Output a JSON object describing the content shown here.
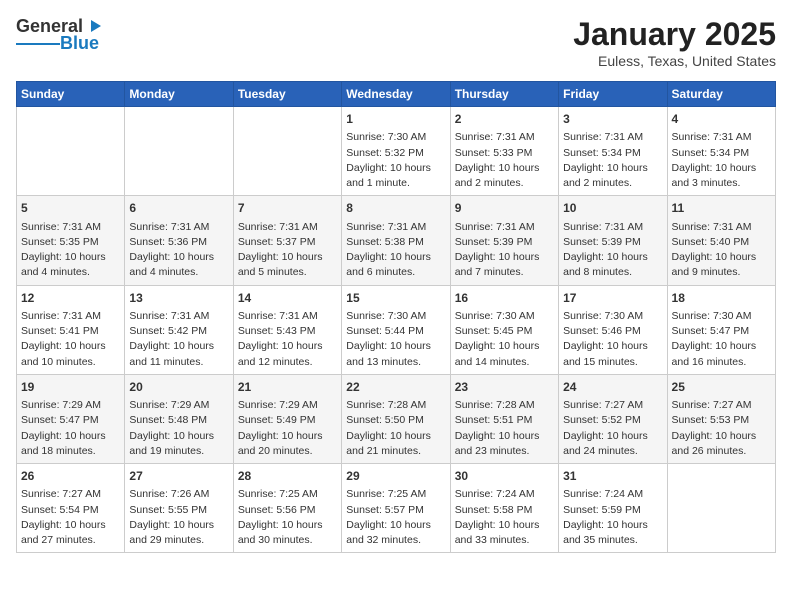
{
  "app": {
    "logo_general": "General",
    "logo_blue": "Blue",
    "title": "January 2025",
    "subtitle": "Euless, Texas, United States"
  },
  "calendar": {
    "headers": [
      "Sunday",
      "Monday",
      "Tuesday",
      "Wednesday",
      "Thursday",
      "Friday",
      "Saturday"
    ],
    "weeks": [
      [
        {
          "day": "",
          "info": ""
        },
        {
          "day": "",
          "info": ""
        },
        {
          "day": "",
          "info": ""
        },
        {
          "day": "1",
          "info": "Sunrise: 7:30 AM\nSunset: 5:32 PM\nDaylight: 10 hours\nand 1 minute."
        },
        {
          "day": "2",
          "info": "Sunrise: 7:31 AM\nSunset: 5:33 PM\nDaylight: 10 hours\nand 2 minutes."
        },
        {
          "day": "3",
          "info": "Sunrise: 7:31 AM\nSunset: 5:34 PM\nDaylight: 10 hours\nand 2 minutes."
        },
        {
          "day": "4",
          "info": "Sunrise: 7:31 AM\nSunset: 5:34 PM\nDaylight: 10 hours\nand 3 minutes."
        }
      ],
      [
        {
          "day": "5",
          "info": "Sunrise: 7:31 AM\nSunset: 5:35 PM\nDaylight: 10 hours\nand 4 minutes."
        },
        {
          "day": "6",
          "info": "Sunrise: 7:31 AM\nSunset: 5:36 PM\nDaylight: 10 hours\nand 4 minutes."
        },
        {
          "day": "7",
          "info": "Sunrise: 7:31 AM\nSunset: 5:37 PM\nDaylight: 10 hours\nand 5 minutes."
        },
        {
          "day": "8",
          "info": "Sunrise: 7:31 AM\nSunset: 5:38 PM\nDaylight: 10 hours\nand 6 minutes."
        },
        {
          "day": "9",
          "info": "Sunrise: 7:31 AM\nSunset: 5:39 PM\nDaylight: 10 hours\nand 7 minutes."
        },
        {
          "day": "10",
          "info": "Sunrise: 7:31 AM\nSunset: 5:39 PM\nDaylight: 10 hours\nand 8 minutes."
        },
        {
          "day": "11",
          "info": "Sunrise: 7:31 AM\nSunset: 5:40 PM\nDaylight: 10 hours\nand 9 minutes."
        }
      ],
      [
        {
          "day": "12",
          "info": "Sunrise: 7:31 AM\nSunset: 5:41 PM\nDaylight: 10 hours\nand 10 minutes."
        },
        {
          "day": "13",
          "info": "Sunrise: 7:31 AM\nSunset: 5:42 PM\nDaylight: 10 hours\nand 11 minutes."
        },
        {
          "day": "14",
          "info": "Sunrise: 7:31 AM\nSunset: 5:43 PM\nDaylight: 10 hours\nand 12 minutes."
        },
        {
          "day": "15",
          "info": "Sunrise: 7:30 AM\nSunset: 5:44 PM\nDaylight: 10 hours\nand 13 minutes."
        },
        {
          "day": "16",
          "info": "Sunrise: 7:30 AM\nSunset: 5:45 PM\nDaylight: 10 hours\nand 14 minutes."
        },
        {
          "day": "17",
          "info": "Sunrise: 7:30 AM\nSunset: 5:46 PM\nDaylight: 10 hours\nand 15 minutes."
        },
        {
          "day": "18",
          "info": "Sunrise: 7:30 AM\nSunset: 5:47 PM\nDaylight: 10 hours\nand 16 minutes."
        }
      ],
      [
        {
          "day": "19",
          "info": "Sunrise: 7:29 AM\nSunset: 5:47 PM\nDaylight: 10 hours\nand 18 minutes."
        },
        {
          "day": "20",
          "info": "Sunrise: 7:29 AM\nSunset: 5:48 PM\nDaylight: 10 hours\nand 19 minutes."
        },
        {
          "day": "21",
          "info": "Sunrise: 7:29 AM\nSunset: 5:49 PM\nDaylight: 10 hours\nand 20 minutes."
        },
        {
          "day": "22",
          "info": "Sunrise: 7:28 AM\nSunset: 5:50 PM\nDaylight: 10 hours\nand 21 minutes."
        },
        {
          "day": "23",
          "info": "Sunrise: 7:28 AM\nSunset: 5:51 PM\nDaylight: 10 hours\nand 23 minutes."
        },
        {
          "day": "24",
          "info": "Sunrise: 7:27 AM\nSunset: 5:52 PM\nDaylight: 10 hours\nand 24 minutes."
        },
        {
          "day": "25",
          "info": "Sunrise: 7:27 AM\nSunset: 5:53 PM\nDaylight: 10 hours\nand 26 minutes."
        }
      ],
      [
        {
          "day": "26",
          "info": "Sunrise: 7:27 AM\nSunset: 5:54 PM\nDaylight: 10 hours\nand 27 minutes."
        },
        {
          "day": "27",
          "info": "Sunrise: 7:26 AM\nSunset: 5:55 PM\nDaylight: 10 hours\nand 29 minutes."
        },
        {
          "day": "28",
          "info": "Sunrise: 7:25 AM\nSunset: 5:56 PM\nDaylight: 10 hours\nand 30 minutes."
        },
        {
          "day": "29",
          "info": "Sunrise: 7:25 AM\nSunset: 5:57 PM\nDaylight: 10 hours\nand 32 minutes."
        },
        {
          "day": "30",
          "info": "Sunrise: 7:24 AM\nSunset: 5:58 PM\nDaylight: 10 hours\nand 33 minutes."
        },
        {
          "day": "31",
          "info": "Sunrise: 7:24 AM\nSunset: 5:59 PM\nDaylight: 10 hours\nand 35 minutes."
        },
        {
          "day": "",
          "info": ""
        }
      ]
    ]
  }
}
